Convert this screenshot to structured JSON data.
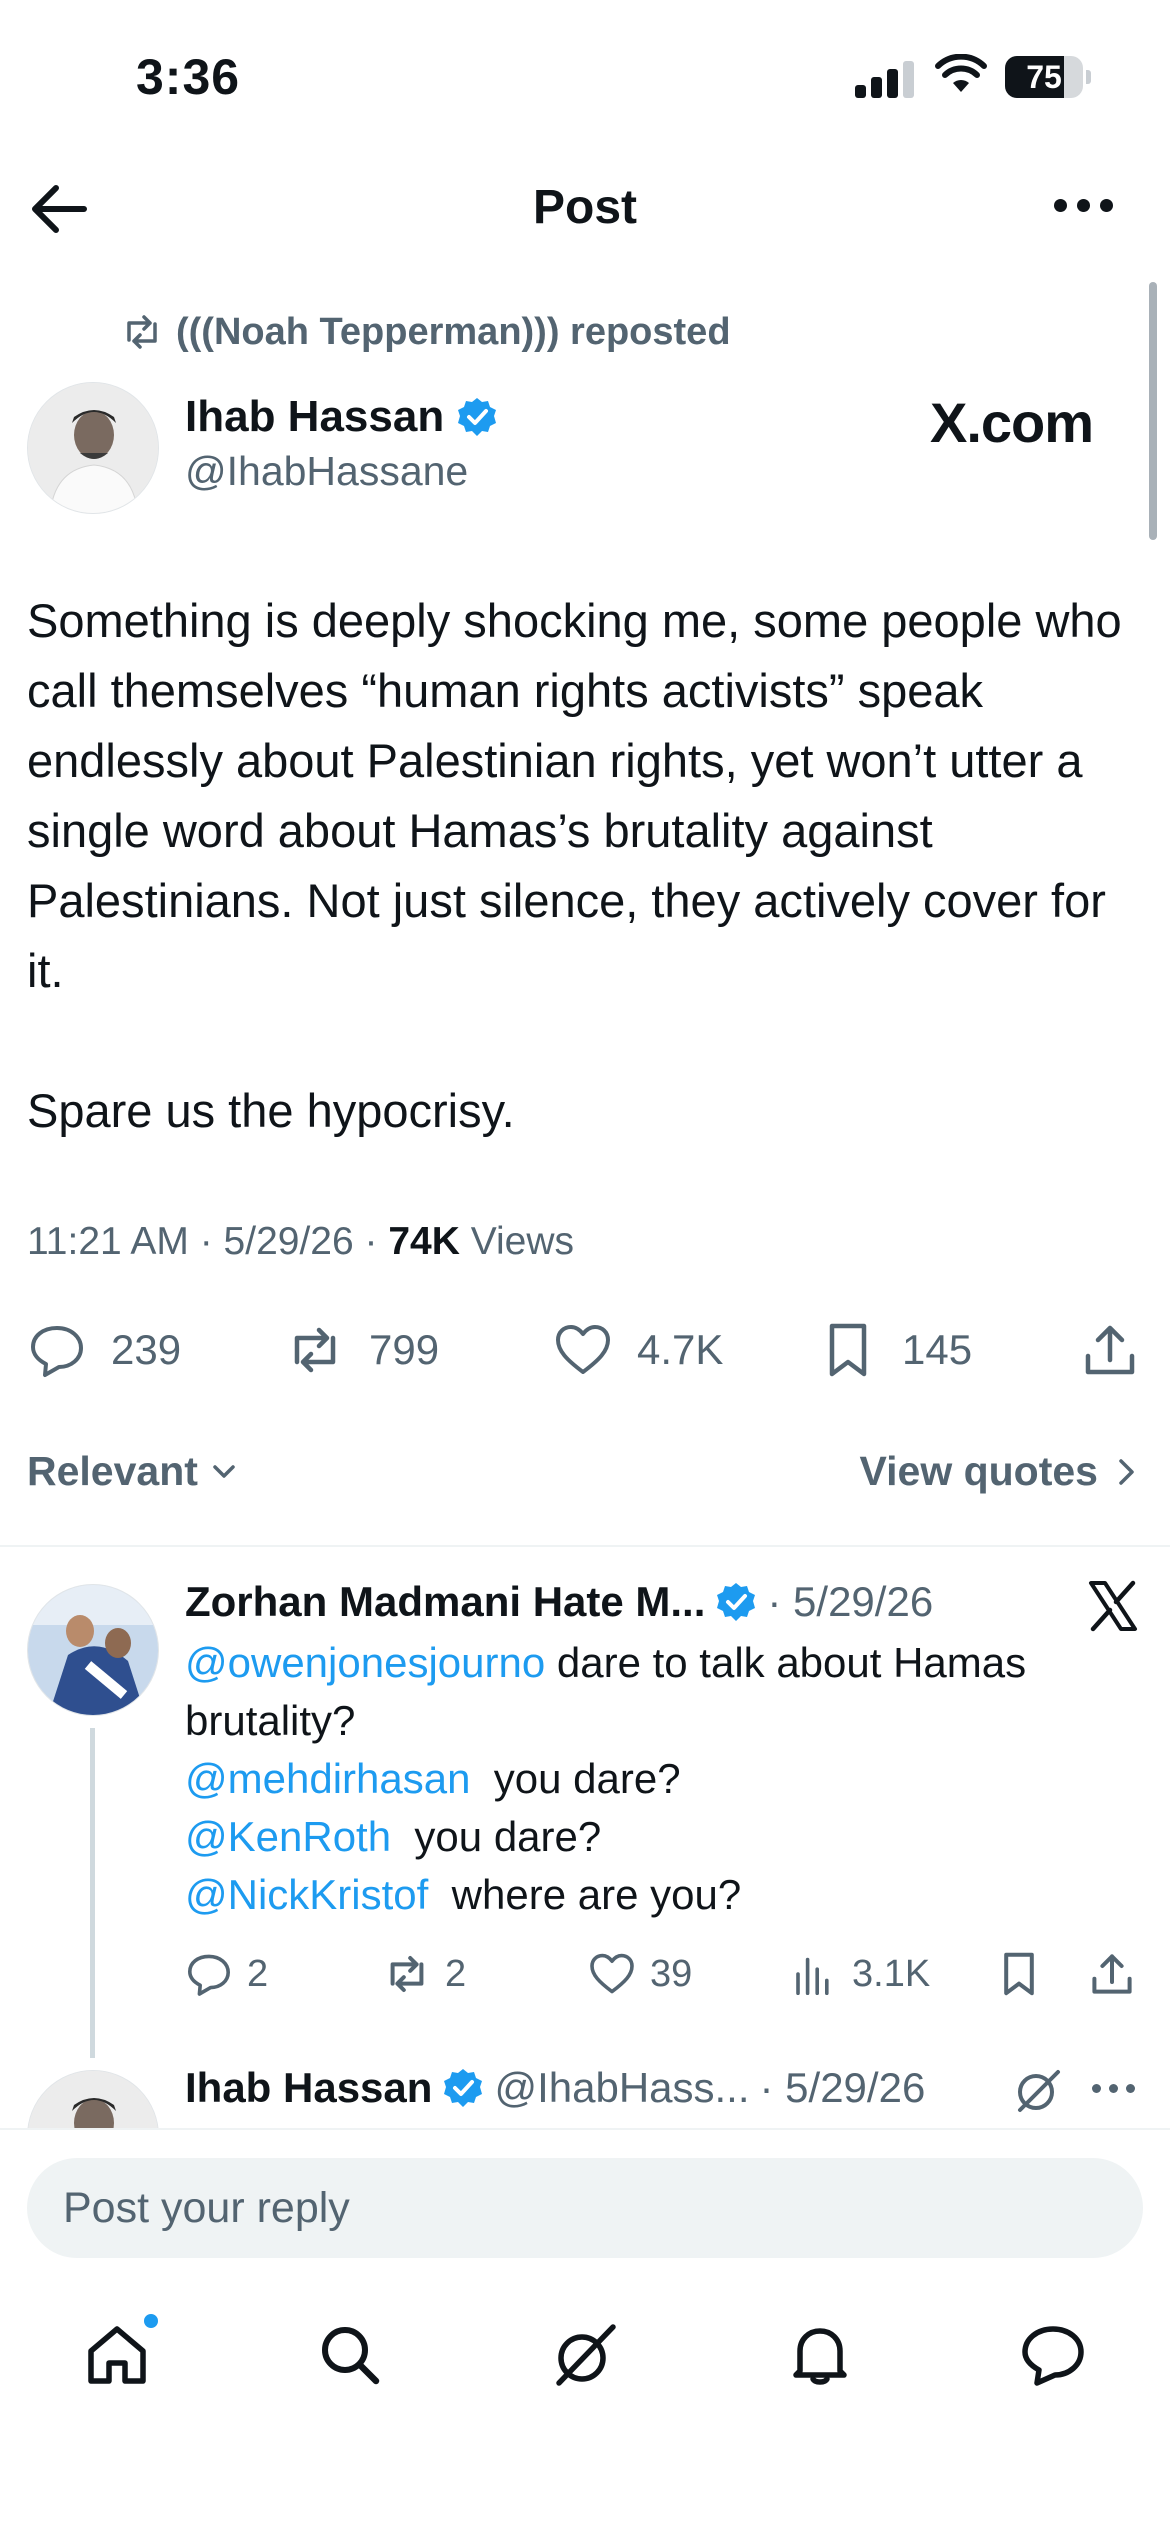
{
  "status_bar": {
    "time": "3:36",
    "battery_percent": "75",
    "battery_level": 0.75
  },
  "header": {
    "title": "Post"
  },
  "post": {
    "repost_text": "(((Noah Tepperman))) reposted",
    "author": {
      "name": "Ihab Hassan",
      "handle": "@IhabHassane",
      "verified": true
    },
    "watermark": "X.com",
    "paragraphs": [
      "Something is deeply shocking me, some people who call themselves “human rights activists” speak endlessly about Palestinian rights, yet won’t utter a single word about Hamas’s brutality against Palestinians. Not just silence, they actively cover for it.",
      "Spare us the hypocrisy."
    ],
    "meta": {
      "time_date": "11:21 AM · 5/29/26 · ",
      "views_count": "74K",
      "views_label": " Views"
    },
    "stats": {
      "replies": "239",
      "reposts": "799",
      "likes": "4.7K",
      "bookmarks": "145"
    }
  },
  "filter": {
    "sort_label": "Relevant",
    "quotes_label": "View quotes"
  },
  "reply": {
    "name": "Zorhan Madmani Hate M...",
    "date": "· 5/29/26",
    "lines": [
      {
        "mention": "@owenjonesjourno",
        "text": " dare to talk about Hamas brutality?"
      },
      {
        "mention": "@mehdirhasan",
        "text": "  you dare?"
      },
      {
        "mention": "@KenRoth",
        "text": "  you dare?"
      },
      {
        "mention": "@NickKristof",
        "text": "  where are you?"
      }
    ],
    "stats": {
      "replies": "2",
      "reposts": "2",
      "likes": "39",
      "views": "3.1K"
    }
  },
  "reply2": {
    "name": "Ihab Hassan",
    "handle": "@IhabHass...",
    "date": "· 5/29/26"
  },
  "composer": {
    "placeholder": "Post your reply"
  },
  "colors": {
    "accent": "#1d9bf0",
    "text": "#0f1419",
    "secondary": "#536471"
  },
  "icons": {
    "back": "arrow-left-icon",
    "more": "more-horizontal-icon",
    "repost": "repost-icon",
    "verified": "verified-badge-icon",
    "reply": "reply-icon",
    "like": "heart-icon",
    "bookmark": "bookmark-icon",
    "share": "share-icon",
    "views": "views-icon",
    "grok": "grok-icon",
    "home": "home-icon",
    "search": "search-icon",
    "notifications": "bell-icon",
    "messages": "chat-icon"
  }
}
